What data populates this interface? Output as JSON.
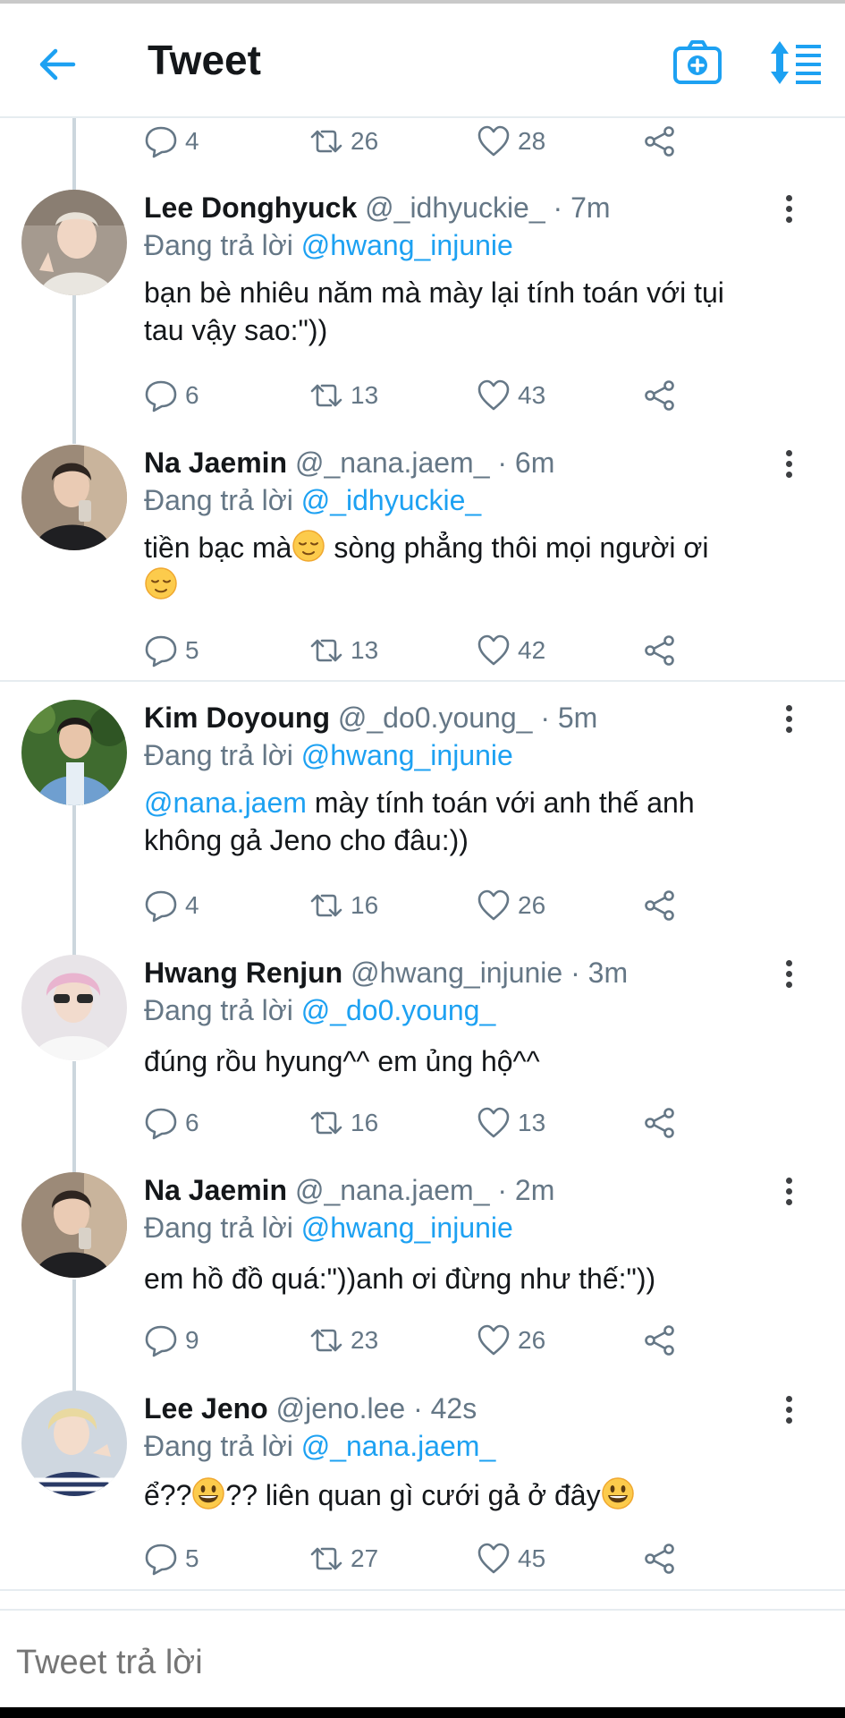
{
  "header": {
    "title": "Tweet",
    "back_icon": "arrow-left-icon",
    "camera_icon": "camera-plus-icon",
    "sort_icon": "sort-list-icon",
    "accent": "#1da1f2"
  },
  "first_tweet_actions": {
    "replies": "4",
    "retweets": "26",
    "likes": "28"
  },
  "tweets": [
    {
      "name": "Lee Donghyuck",
      "handle": "@_idhyuckie_",
      "time": "· 7m",
      "reply_prefix": "Đang trả lời",
      "reply_to": "@hwang_injunie",
      "text_line1": "bạn bè nhiêu năm mà mày lại tính toán với tụi",
      "text_line2": "tau vậy sao:\"))",
      "replies": "6",
      "retweets": "13",
      "likes": "43"
    },
    {
      "name": "Na Jaemin",
      "handle": "@_nana.jaem_",
      "time": "· 6m",
      "reply_prefix": "Đang trả lời",
      "reply_to": "@_idhyuckie_",
      "text_a": "tiền bạc mà",
      "text_b": " sòng phẳng thôi mọi người ơi",
      "replies": "5",
      "retweets": "13",
      "likes": "42"
    },
    {
      "name": "Kim Doyoung",
      "handle": "@_do0.young_",
      "time": "· 5m",
      "reply_prefix": "Đang trả lời",
      "reply_to": "@hwang_injunie",
      "text_mention": "@nana.jaem",
      "text_line1": " mày tính toán với anh thế anh",
      "text_line2": "không gả Jeno cho đâu:))",
      "replies": "4",
      "retweets": "16",
      "likes": "26"
    },
    {
      "name": "Hwang Renjun",
      "handle": "@hwang_injunie",
      "time": "· 3m",
      "reply_prefix": "Đang trả lời",
      "reply_to": "@_do0.young_",
      "text": "đúng rồu hyung^^ em ủng hộ^^",
      "replies": "6",
      "retweets": "16",
      "likes": "13"
    },
    {
      "name": "Na Jaemin",
      "handle": "@_nana.jaem_",
      "time": "· 2m",
      "reply_prefix": "Đang trả lời",
      "reply_to": "@hwang_injunie",
      "text": "em hồ đồ quá:\"))anh ơi đừng như thế:\"))",
      "replies": "9",
      "retweets": "23",
      "likes": "26"
    },
    {
      "name": "Lee Jeno",
      "handle": "@jeno.lee",
      "time": "· 42s",
      "reply_prefix": "Đang trả lời",
      "reply_to": "@_nana.jaem_",
      "text_a": "ể??",
      "text_b": "?? liên quan gì cưới gả ở đây",
      "replies": "5",
      "retweets": "27",
      "likes": "45"
    }
  ],
  "compose": {
    "placeholder": "Tweet trả lời"
  }
}
